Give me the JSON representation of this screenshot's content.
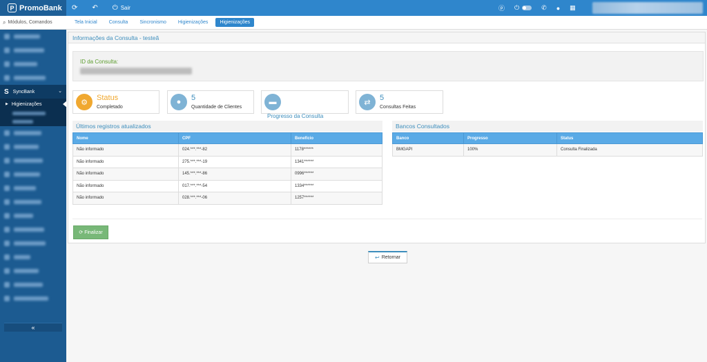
{
  "brand": {
    "logo_letter": "P",
    "name": "PromoBank"
  },
  "toolbar": {
    "sair_label": "Sair"
  },
  "sidebar": {
    "search_placeholder": "Módulos, Comandos",
    "section_label": "SyncBank",
    "section_letter": "S",
    "active_item": "Higienizações",
    "collapse_glyph": "«"
  },
  "tabs": [
    {
      "label": "Tela Inicial"
    },
    {
      "label": "Consulta"
    },
    {
      "label": "Sincronismo"
    },
    {
      "label": "Higienizações"
    },
    {
      "label": "Higienizações",
      "active": true
    }
  ],
  "panel": {
    "title": "Informações da Consulta - testeã",
    "id_label": "ID da Consulta:"
  },
  "infoboxes": [
    {
      "big": "Status",
      "small": "Completado",
      "icon": "gear-icon",
      "color": "#f0a830"
    },
    {
      "big": "5",
      "small": "Quantidade de Clientes",
      "icon": "user-icon",
      "color": "#7fb3d5"
    },
    {
      "big": "",
      "small": "",
      "icon": "progress-icon",
      "color": "#7fb3d5"
    },
    {
      "big": "5",
      "small": "Consultas Feitas",
      "icon": "exchange-icon",
      "color": "#7fb3d5"
    }
  ],
  "progress_label": "Progresso da Consulta",
  "records": {
    "title": "Últimos registros atualizados",
    "columns": [
      "Nome",
      "CPF",
      "Benefício"
    ],
    "rows": [
      [
        "Não informado",
        "024.***.***-82",
        "1178******"
      ],
      [
        "Não informado",
        "275.***.***-19",
        "1341******"
      ],
      [
        "Não informado",
        "145.***.***-86",
        "0996******"
      ],
      [
        "Não informado",
        "017.***.***-54",
        "1334******"
      ],
      [
        "Não informado",
        "028.***.***-06",
        "1257******"
      ]
    ]
  },
  "banks": {
    "title": "Bancos Consultados",
    "columns": [
      "Banco",
      "Progresso",
      "Status"
    ],
    "rows": [
      [
        "BMGAPI",
        "100%",
        "Consulta Finalizada"
      ]
    ]
  },
  "buttons": {
    "finalizar": "Finalizar",
    "retornar": "Retornar"
  },
  "colors": {
    "topbar": "#2f86cc",
    "sidebar": "#1c5b91",
    "table_header": "#5aaae6",
    "finalizar": "#78b878"
  }
}
